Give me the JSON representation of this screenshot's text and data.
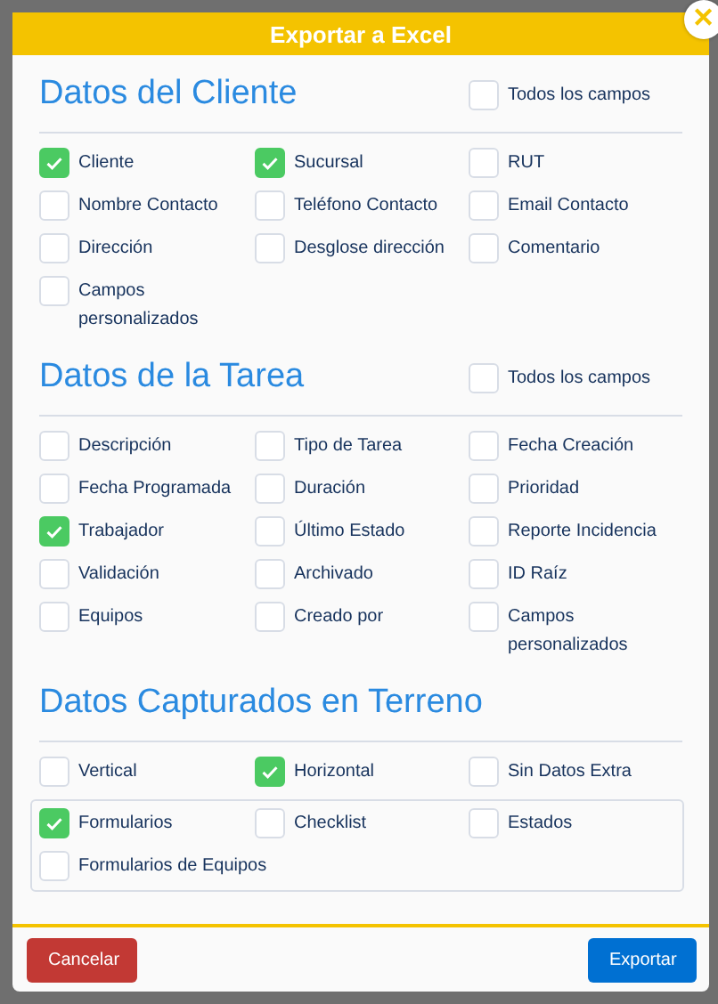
{
  "dialog": {
    "title": "Exportar a Excel",
    "close_icon": "✕"
  },
  "sections": [
    {
      "title": "Datos del Cliente",
      "select_all": {
        "label": "Todos los campos",
        "checked": false
      },
      "groups": [
        {
          "boxed": false,
          "items": [
            {
              "label": "Cliente",
              "checked": true
            },
            {
              "label": "Sucursal",
              "checked": true
            },
            {
              "label": "RUT",
              "checked": false
            },
            {
              "label": "Nombre Contacto",
              "checked": false
            },
            {
              "label": "Teléfono Contacto",
              "checked": false
            },
            {
              "label": "Email Contacto",
              "checked": false
            },
            {
              "label": "Dirección",
              "checked": false
            },
            {
              "label": "Desglose dirección",
              "checked": false
            },
            {
              "label": "Comentario",
              "checked": false
            },
            {
              "label": "Campos personalizados",
              "checked": false
            }
          ]
        }
      ]
    },
    {
      "title": "Datos de la Tarea",
      "select_all": {
        "label": "Todos los campos",
        "checked": false
      },
      "groups": [
        {
          "boxed": false,
          "items": [
            {
              "label": "Descripción",
              "checked": false
            },
            {
              "label": "Tipo de Tarea",
              "checked": false
            },
            {
              "label": "Fecha Creación",
              "checked": false
            },
            {
              "label": "Fecha Programada",
              "checked": false
            },
            {
              "label": "Duración",
              "checked": false
            },
            {
              "label": "Prioridad",
              "checked": false
            },
            {
              "label": "Trabajador",
              "checked": true
            },
            {
              "label": "Último Estado",
              "checked": false
            },
            {
              "label": "Reporte Incidencia",
              "checked": false
            },
            {
              "label": "Validación",
              "checked": false
            },
            {
              "label": "Archivado",
              "checked": false
            },
            {
              "label": "ID Raíz",
              "checked": false
            },
            {
              "label": "Equipos",
              "checked": false
            },
            {
              "label": "Creado por",
              "checked": false
            },
            {
              "label": "Campos personalizados",
              "checked": false
            }
          ]
        }
      ]
    },
    {
      "title": "Datos Capturados en Terreno",
      "groups": [
        {
          "boxed": false,
          "items": [
            {
              "label": "Vertical",
              "checked": false
            },
            {
              "label": "Horizontal",
              "checked": true
            },
            {
              "label": "Sin Datos Extra",
              "checked": false
            }
          ]
        },
        {
          "boxed": true,
          "items": [
            {
              "label": "Formularios",
              "checked": true
            },
            {
              "label": "Checklist",
              "checked": false
            },
            {
              "label": "Estados",
              "checked": false
            },
            {
              "label": "Formularios de Equipos",
              "checked": false
            }
          ]
        }
      ]
    }
  ],
  "buttons": [
    {
      "label": "Cancelar",
      "kind": "cancel"
    },
    {
      "label": "Exportar",
      "kind": "primary"
    }
  ]
}
